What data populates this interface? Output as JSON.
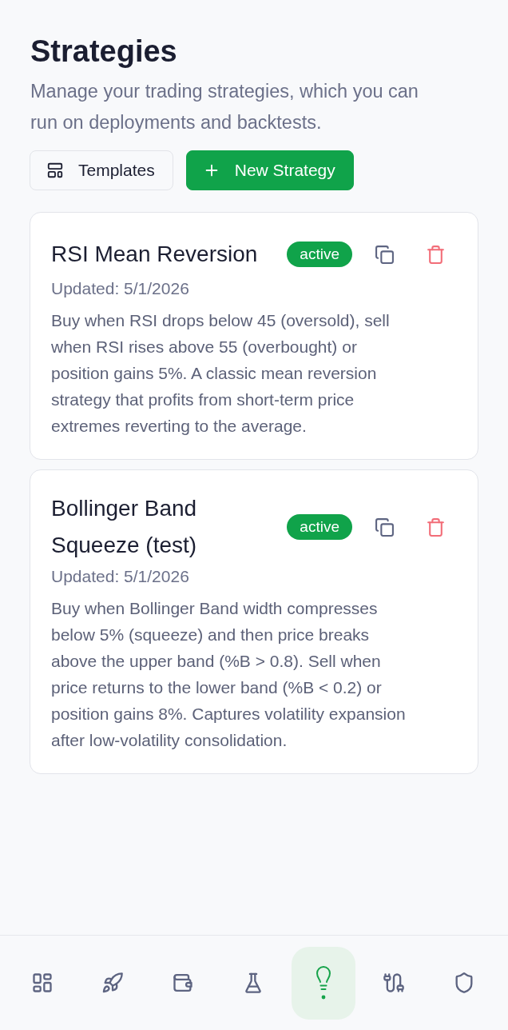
{
  "page": {
    "title": "Strategies",
    "subtitle": "Manage your trading strategies, which you can run on deployments and backtests."
  },
  "actions": [
    {
      "kind": "templates",
      "label": "Templates"
    },
    {
      "kind": "new",
      "label": "New Strategy"
    }
  ],
  "strategies": [
    {
      "name": "RSI Mean Reversion",
      "status": "active",
      "updated": "Updated: 5/1/2026",
      "description": "Buy when RSI drops below 45 (oversold), sell when RSI rises above 55 (overbought) or position gains 5%. A classic mean reversion strategy that profits from short-term price extremes reverting to the average."
    },
    {
      "name": "Bollinger Band Squeeze (test)",
      "status": "active",
      "updated": "Updated: 5/1/2026",
      "description": "Buy when Bollinger Band width compresses below 5% (squeeze) and then price breaks above the upper band (%B > 0.8). Sell when price returns to the lower band (%B < 0.2) or position gains 8%. Captures volatility expansion after low-volatility consolidation."
    }
  ],
  "bottom_nav": [
    {
      "kind": "grid",
      "selected": false
    },
    {
      "kind": "rocket",
      "selected": false
    },
    {
      "kind": "wallet",
      "selected": false
    },
    {
      "kind": "flask",
      "selected": false
    },
    {
      "kind": "bulb",
      "selected": true
    },
    {
      "kind": "plug",
      "selected": false
    },
    {
      "kind": "shield",
      "selected": false
    }
  ]
}
